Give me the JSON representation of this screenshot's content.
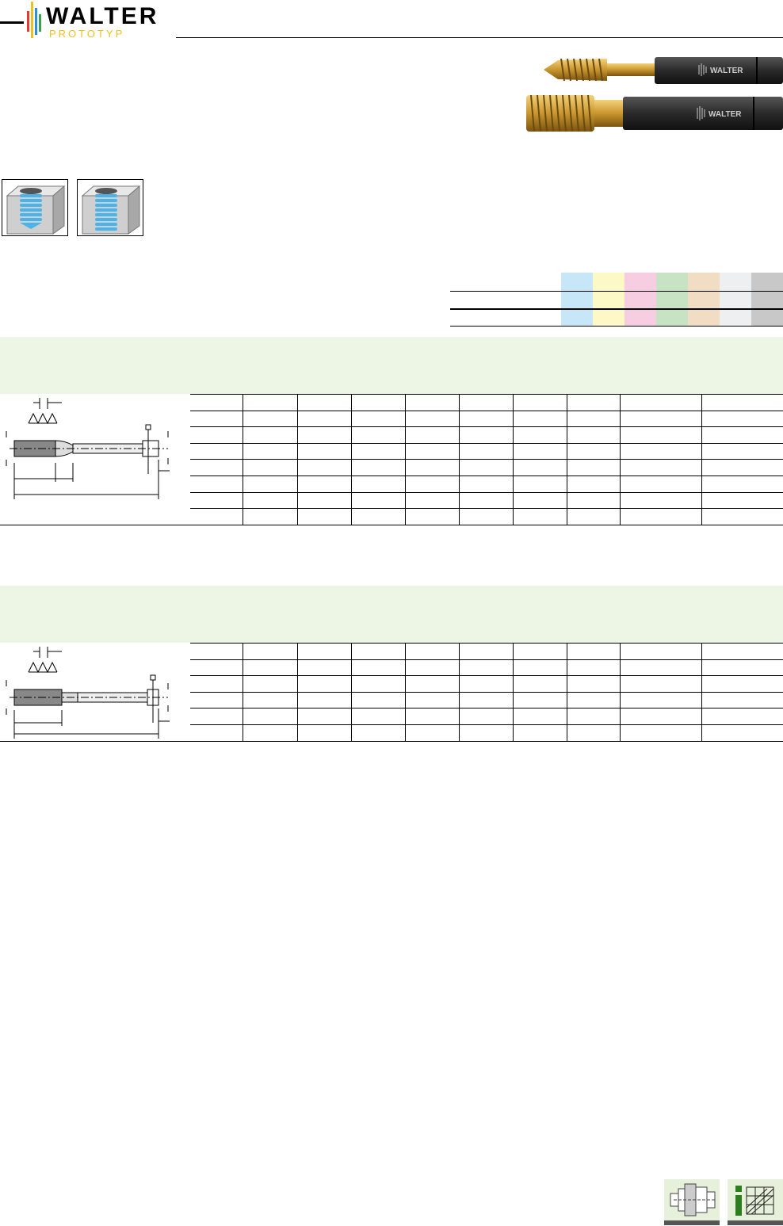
{
  "brand": {
    "name": "WALTER",
    "subname": "PROTOTYP",
    "bar_colors": [
      "#e63a2e",
      "#f0c020",
      "#2f8fd6",
      "#3aa54a"
    ]
  },
  "material_legend": {
    "colors": [
      "#c7e6f8",
      "#fdf9c6",
      "#f7cde2",
      "#c7e3c3",
      "#f1dcc4",
      "#edeff1",
      "#c8c8c8"
    ]
  },
  "background_band_color": "#edf5e4",
  "table_1": {
    "rows": 8,
    "columns": 11
  },
  "table_2": {
    "rows": 6,
    "columns": 11
  },
  "bottom_icons": [
    "tool-holder-icon",
    "info-chart-icon"
  ]
}
